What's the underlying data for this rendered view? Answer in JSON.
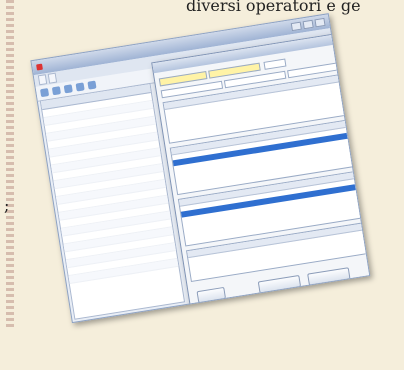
{
  "page": {
    "header_text": "diversi operatori e ge",
    "side_glyph": ";"
  },
  "app": {
    "title_bar": "",
    "tabs": [
      "",
      ""
    ]
  },
  "grid": {
    "rows": 22
  },
  "dialog": {
    "title": ""
  }
}
